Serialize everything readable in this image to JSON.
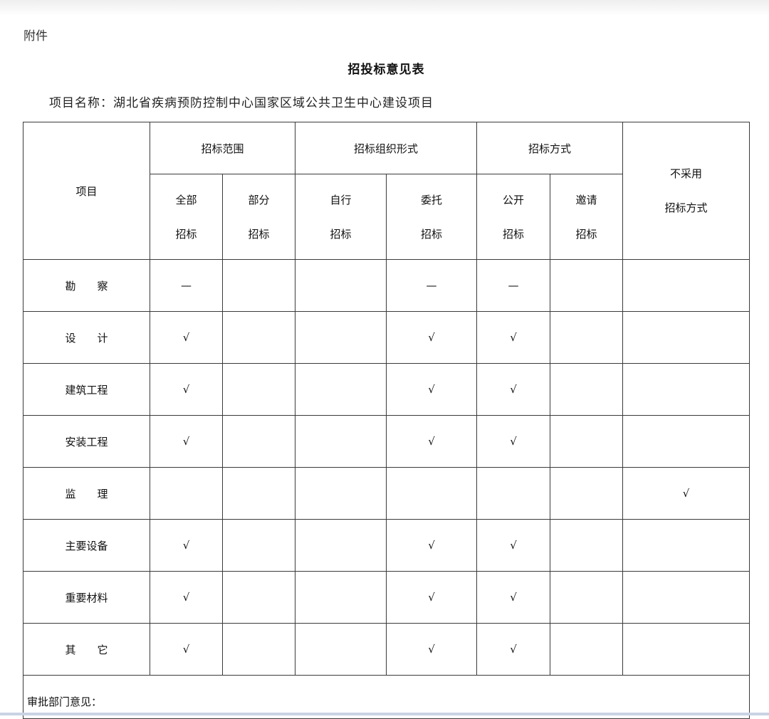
{
  "attachment_label": "附件",
  "title": "招投标意见表",
  "project_line": "项目名称：湖北省疾病预防控制中心国家区域公共卫生中心建设项目",
  "table": {
    "header_item": "项目",
    "group_scope": "招标范围",
    "group_org": "招标组织形式",
    "group_method": "招标方式",
    "no_tender": [
      "不采用",
      "招标方式"
    ],
    "sub_headers": [
      [
        "全部",
        "招标"
      ],
      [
        "部分",
        "招标"
      ],
      [
        "自行",
        "招标"
      ],
      [
        "委托",
        "招标"
      ],
      [
        "公开",
        "招标"
      ],
      [
        "邀请",
        "招标"
      ]
    ],
    "rows": [
      {
        "label": "勘　　察",
        "cells": [
          "—",
          "",
          "",
          "—",
          "—",
          "",
          ""
        ]
      },
      {
        "label": "设　　计",
        "cells": [
          "√",
          "",
          "",
          "√",
          "√",
          "",
          ""
        ]
      },
      {
        "label": "建筑工程",
        "cells": [
          "√",
          "",
          "",
          "√",
          "√",
          "",
          ""
        ]
      },
      {
        "label": "安装工程",
        "cells": [
          "√",
          "",
          "",
          "√",
          "√",
          "",
          ""
        ]
      },
      {
        "label": "监　　理",
        "cells": [
          "",
          "",
          "",
          "",
          "",
          "",
          "√"
        ]
      },
      {
        "label": "主要设备",
        "cells": [
          "√",
          "",
          "",
          "√",
          "√",
          "",
          ""
        ]
      },
      {
        "label": "重要材料",
        "cells": [
          "√",
          "",
          "",
          "√",
          "√",
          "",
          ""
        ]
      },
      {
        "label": "其　　它",
        "cells": [
          "√",
          "",
          "",
          "√",
          "√",
          "",
          ""
        ]
      }
    ],
    "approval_label": "审批部门意见："
  }
}
